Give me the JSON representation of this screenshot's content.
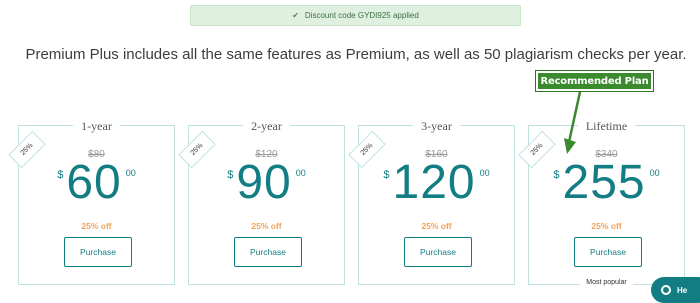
{
  "notice": {
    "text": "Discount code GYDI925 applied",
    "icon": "check-icon"
  },
  "headline": "Premium Plus includes all the same features as Premium, as well as 50 plagiarism checks per year.",
  "recommended_label": "Recommended Plan",
  "plans": [
    {
      "title": "1-year",
      "tag": "25%",
      "old_price": "$80",
      "currency": "$",
      "amount": "60",
      "cents": "00",
      "discount": "25% off",
      "button": "Purchase"
    },
    {
      "title": "2-year",
      "tag": "25%",
      "old_price": "$120",
      "currency": "$",
      "amount": "90",
      "cents": "00",
      "discount": "25% off",
      "button": "Purchase"
    },
    {
      "title": "3-year",
      "tag": "25%",
      "old_price": "$160",
      "currency": "$",
      "amount": "120",
      "cents": "00",
      "discount": "25% off",
      "button": "Purchase"
    },
    {
      "title": "Lifetime",
      "tag": "25%",
      "old_price": "$340",
      "currency": "$",
      "amount": "255",
      "cents": "00",
      "discount": "25% off",
      "button": "Purchase",
      "badge": "Most popular"
    }
  ],
  "help": {
    "label": "He"
  },
  "colors": {
    "accent": "#127d82",
    "discount": "#f0a35a",
    "recommended": "#3b8a2e",
    "notice_bg": "#dff0e0"
  }
}
